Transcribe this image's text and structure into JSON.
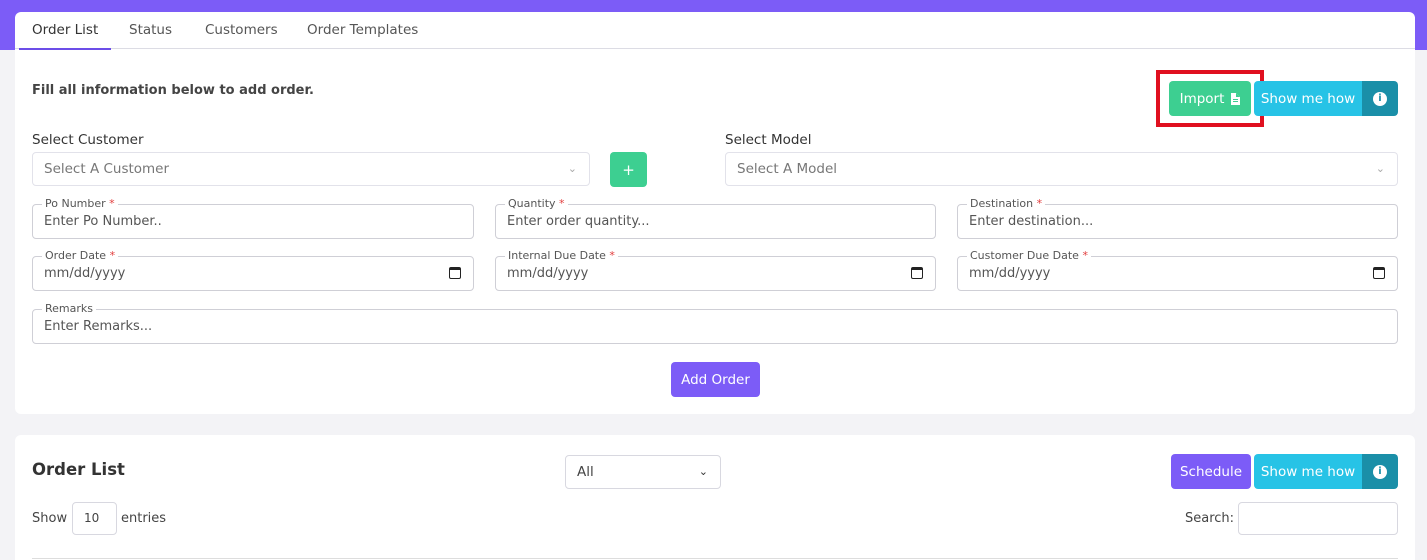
{
  "tabs": [
    "Order List",
    "Status",
    "Customers",
    "Order Templates"
  ],
  "form": {
    "intro": "Fill all information below to add order.",
    "import_label": "Import",
    "show_me_how": "Show me how",
    "info_glyph": "i",
    "customer_label": "Select Customer",
    "customer_placeholder": "Select A Customer",
    "plus_glyph": "+",
    "model_label": "Select Model",
    "model_placeholder": "Select A Model",
    "po": {
      "label": "Po Number",
      "placeholder": "Enter Po Number.."
    },
    "quantity": {
      "label": "Quantity",
      "placeholder": "Enter order quantity..."
    },
    "destination": {
      "label": "Destination",
      "placeholder": "Enter destination..."
    },
    "order_date": {
      "label": "Order Date",
      "placeholder": "mm/dd/yyyy"
    },
    "internal_due": {
      "label": "Internal Due Date",
      "placeholder": "mm/dd/yyyy"
    },
    "customer_due": {
      "label": "Customer Due Date",
      "placeholder": "mm/dd/yyyy"
    },
    "remarks": {
      "label": "Remarks",
      "placeholder": "Enter Remarks..."
    },
    "required_mark": "*",
    "add_order": "Add Order"
  },
  "list": {
    "title": "Order List",
    "filter_value": "All",
    "schedule": "Schedule",
    "show_me_how": "Show me how",
    "show_label": "Show",
    "entries_value": "10",
    "entries_label": "entries",
    "search_label": "Search:"
  },
  "colors": {
    "accent": "#7c5cf7",
    "green": "#3dcf91",
    "cyan": "#27c3e6",
    "teal": "#1a8fa8",
    "highlight": "#e0101f"
  },
  "icons": [
    "file-icon",
    "info-icon",
    "plus-icon",
    "chevron-down-icon",
    "calendar-icon"
  ]
}
